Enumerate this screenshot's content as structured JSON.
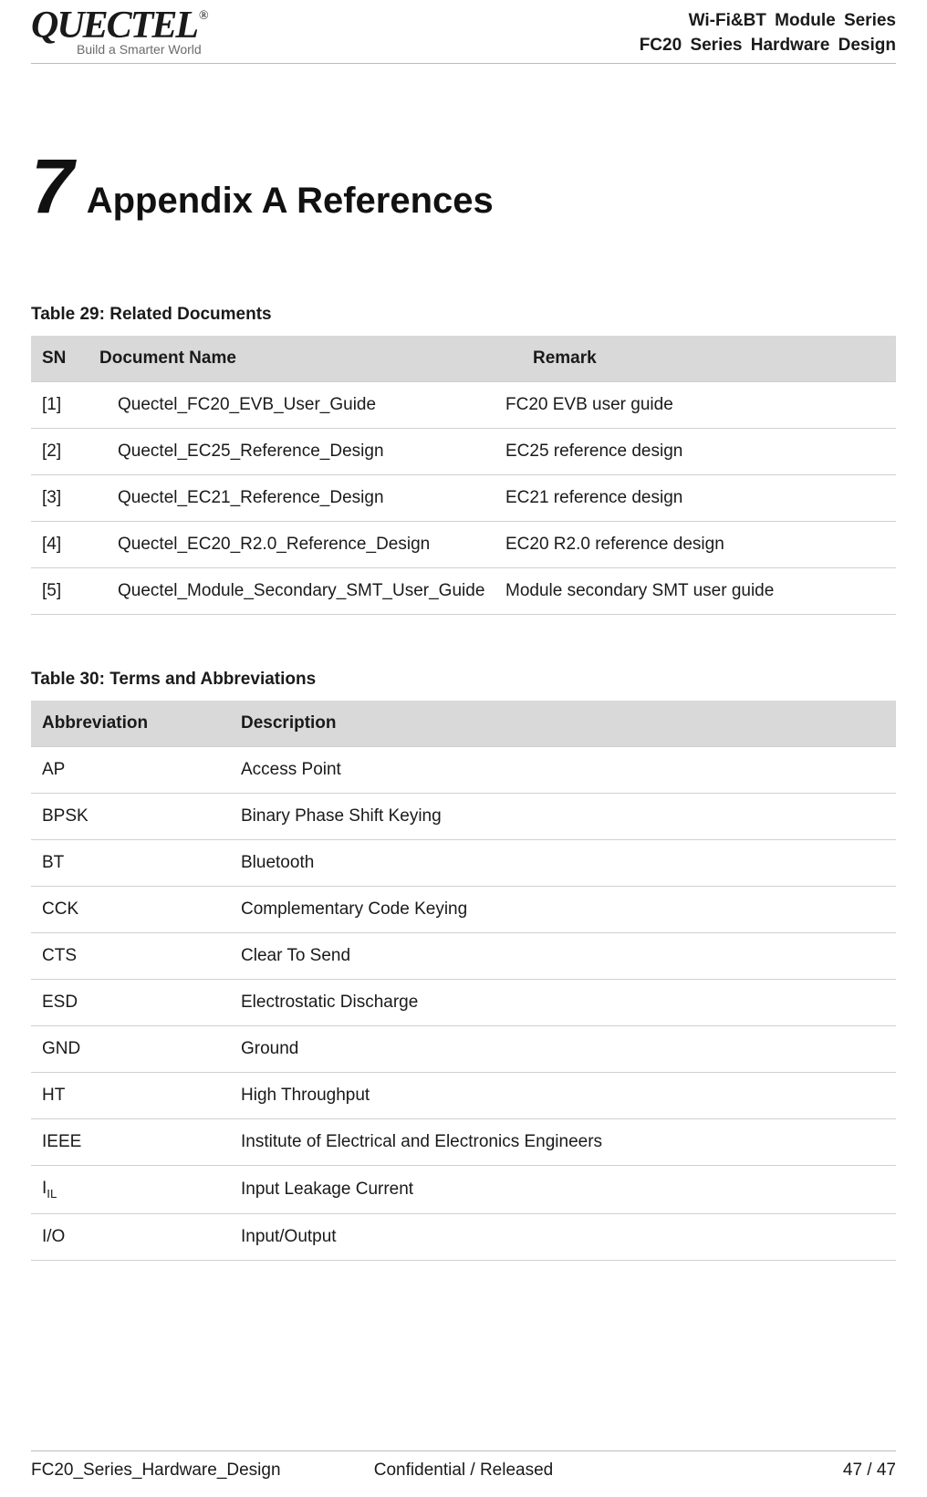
{
  "header": {
    "logo_name": "QUECTEL",
    "registered": "®",
    "tagline": "Build a Smarter World",
    "line1": "Wi-Fi&BT Module Series",
    "line2": "FC20 Series Hardware Design"
  },
  "chapter": {
    "number": "7",
    "title": "Appendix A References"
  },
  "table29": {
    "caption": "Table 29: Related Documents",
    "headers": {
      "sn": "SN",
      "name": "Document Name",
      "remark": "Remark"
    },
    "rows": [
      {
        "sn": "[1]",
        "name": "Quectel_FC20_EVB_User_Guide",
        "remark": "FC20 EVB user guide"
      },
      {
        "sn": "[2]",
        "name": "Quectel_EC25_Reference_Design",
        "remark": "EC25 reference design"
      },
      {
        "sn": "[3]",
        "name": "Quectel_EC21_Reference_Design",
        "remark": "EC21 reference design"
      },
      {
        "sn": "[4]",
        "name": "Quectel_EC20_R2.0_Reference_Design",
        "remark": "EC20 R2.0 reference design"
      },
      {
        "sn": "[5]",
        "name": "Quectel_Module_Secondary_SMT_User_Guide",
        "remark": "Module secondary SMT user guide"
      }
    ]
  },
  "table30": {
    "caption": "Table 30: Terms and Abbreviations",
    "headers": {
      "abbr": "Abbreviation",
      "desc": "Description"
    },
    "rows": [
      {
        "abbr": "AP",
        "desc": "Access Point"
      },
      {
        "abbr": "BPSK",
        "desc": "Binary Phase Shift Keying"
      },
      {
        "abbr": "BT",
        "desc": "Bluetooth"
      },
      {
        "abbr": "CCK",
        "desc": "Complementary Code Keying"
      },
      {
        "abbr": "CTS",
        "desc": "Clear To Send"
      },
      {
        "abbr": "ESD",
        "desc": "Electrostatic Discharge"
      },
      {
        "abbr": "GND",
        "desc": "Ground"
      },
      {
        "abbr": "HT",
        "desc": "High Throughput"
      },
      {
        "abbr": "IEEE",
        "desc": "Institute of Electrical and Electronics Engineers"
      },
      {
        "abbr_html": "I<sub>IL</sub>",
        "desc": "Input Leakage Current"
      },
      {
        "abbr": "I/O",
        "desc": "Input/Output"
      }
    ]
  },
  "footer": {
    "left": "FC20_Series_Hardware_Design",
    "center": "Confidential / Released",
    "right": "47 / 47"
  }
}
